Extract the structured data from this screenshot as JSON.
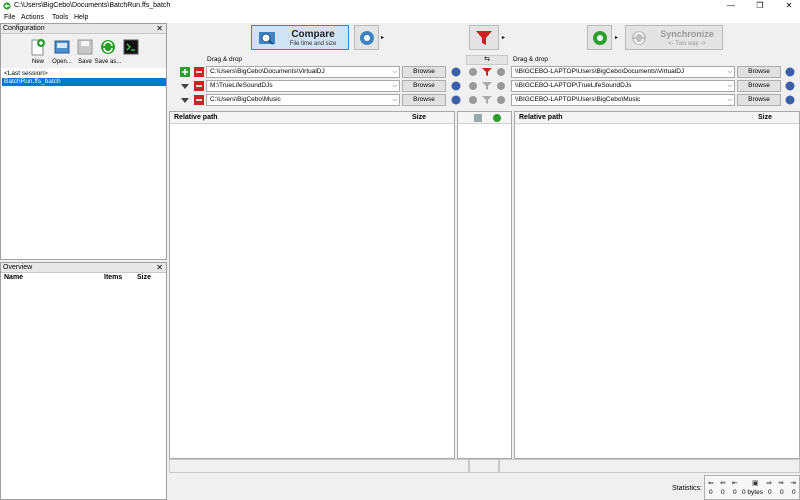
{
  "window": {
    "title": "C:\\Users\\BigCebo\\Documents\\BatchRun.ffs_batch",
    "minimize": "—",
    "maximize": "❐",
    "close": "✕"
  },
  "menu": [
    "File",
    "Actions",
    "Tools",
    "Help"
  ],
  "config": {
    "title": "Configuration",
    "close": "✕",
    "tools": [
      "New",
      "Open...",
      "Save",
      "Save as..."
    ],
    "sessions": [
      "<Last session>",
      "BatchRun.ffs_batch"
    ]
  },
  "overview": {
    "title": "Overview",
    "close": "✕",
    "columns": [
      "Name",
      "Items",
      "Size"
    ]
  },
  "toolbar": {
    "compare_title": "Compare",
    "compare_sub": "File time and size",
    "sync_title": "Synchronize",
    "sync_sub": "<- Two way ->",
    "arrow": "▸"
  },
  "left_folders": {
    "drag_label": "Drag & drop",
    "paths": [
      "C:\\Users\\BigCebo\\Documents\\VirtualDJ",
      "M:\\TrueLifeSoundDJs",
      "C:\\Users\\BigCebo\\Music"
    ],
    "browse": "Browse"
  },
  "right_folders": {
    "drag_label": "Drag & drop",
    "paths": [
      "\\\\BIGCEBO-LAPTOP\\Users\\BigCebo\\Documents\\VirtualDJ",
      "\\\\BIGCEBO-LAPTOP\\TrueLifeSoundDJs",
      "\\\\BIGCEBO-LAPTOP\\Users\\BigCebo\\Music"
    ],
    "browse": "Browse"
  },
  "left_grid": {
    "col_path": "Relative path",
    "col_size": "Size"
  },
  "right_grid": {
    "col_path": "Relative path",
    "col_size": "Size"
  },
  "statistics": {
    "label": "Statistics:",
    "values": [
      "0",
      "0",
      "0",
      "0 bytes",
      "0",
      "0",
      "0"
    ]
  },
  "colors": {
    "accent": "#0078d7",
    "compare_bg": "#cfe3f5",
    "green": "#2a9d2a",
    "red": "#cc2222"
  }
}
